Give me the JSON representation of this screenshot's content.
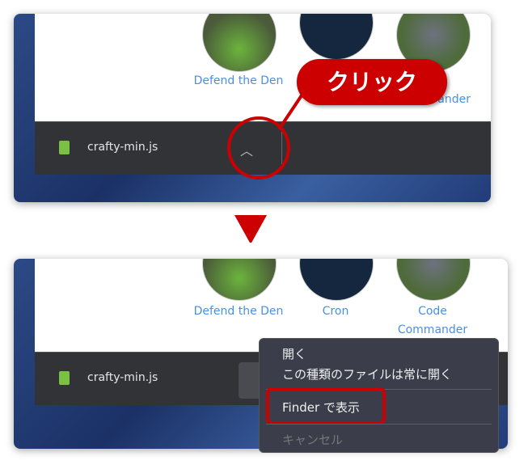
{
  "top": {
    "captions": [
      "Defend the Den",
      "ander"
    ],
    "file": "crafty-min.js",
    "callout": "クリック",
    "chevron": "chevron-up-icon"
  },
  "bottom": {
    "captions": [
      "Defend the Den",
      "Cron",
      "Code",
      "Commander"
    ],
    "file": "crafty-min.js",
    "menu": [
      "開く",
      "この種類のファイルは常に開く",
      "Finder で表示",
      "キャンセル"
    ]
  },
  "colors": {
    "accent": "#cc0000",
    "link": "#4a90e2",
    "bar": "#323337"
  }
}
